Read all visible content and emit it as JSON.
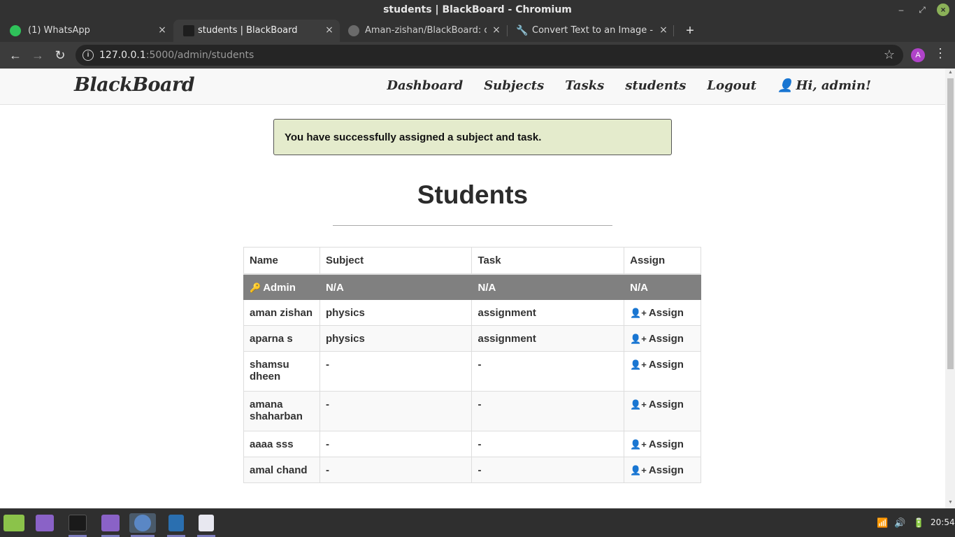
{
  "window": {
    "title": "students | BlackBoard - Chromium"
  },
  "tabs": [
    {
      "label": "(1) WhatsApp",
      "icon": "whatsapp-icon"
    },
    {
      "label": "students | BlackBoard",
      "icon": "blackboard-favicon",
      "active": true
    },
    {
      "label": "Aman-zishan/BlackBoard: class",
      "icon": "github-icon"
    },
    {
      "label": "Convert Text to an Image - Onli",
      "icon": "wrench-icon"
    }
  ],
  "toolbar": {
    "url_host": "127.0.0.1",
    "url_path": ":5000/admin/students",
    "profile_initial": "A"
  },
  "navbar": {
    "brand": "BlackBoard",
    "links": [
      "Dashboard",
      "Subjects",
      "Tasks",
      "students",
      "Logout"
    ],
    "greeting": "Hi, admin!"
  },
  "alert": {
    "message": "You have successfully assigned a subject and task."
  },
  "page": {
    "heading": "Students"
  },
  "table": {
    "headers": [
      "Name",
      "Subject",
      "Task",
      "Assign"
    ],
    "admin_row": {
      "name": "Admin",
      "subject": "N/A",
      "task": "N/A",
      "assign": "N/A"
    },
    "rows": [
      {
        "name": "aman zishan",
        "subject": "physics",
        "task": "assignment",
        "assign": "Assign"
      },
      {
        "name": "aparna s",
        "subject": "physics",
        "task": "assignment",
        "assign": "Assign"
      },
      {
        "name": "shamsu dheen",
        "subject": "-",
        "task": "-",
        "assign": "Assign"
      },
      {
        "name": "amana shaharban",
        "subject": "-",
        "task": "-",
        "assign": "Assign"
      },
      {
        "name": "aaaa sss",
        "subject": "-",
        "task": "-",
        "assign": "Assign"
      },
      {
        "name": "amal chand",
        "subject": "-",
        "task": "-",
        "assign": "Assign"
      }
    ]
  },
  "taskbar": {
    "clock": "20:54"
  },
  "colors": {
    "alert_bg": "#e4ebcc",
    "admin_row_bg": "#808080",
    "accent": "#b043c9"
  }
}
